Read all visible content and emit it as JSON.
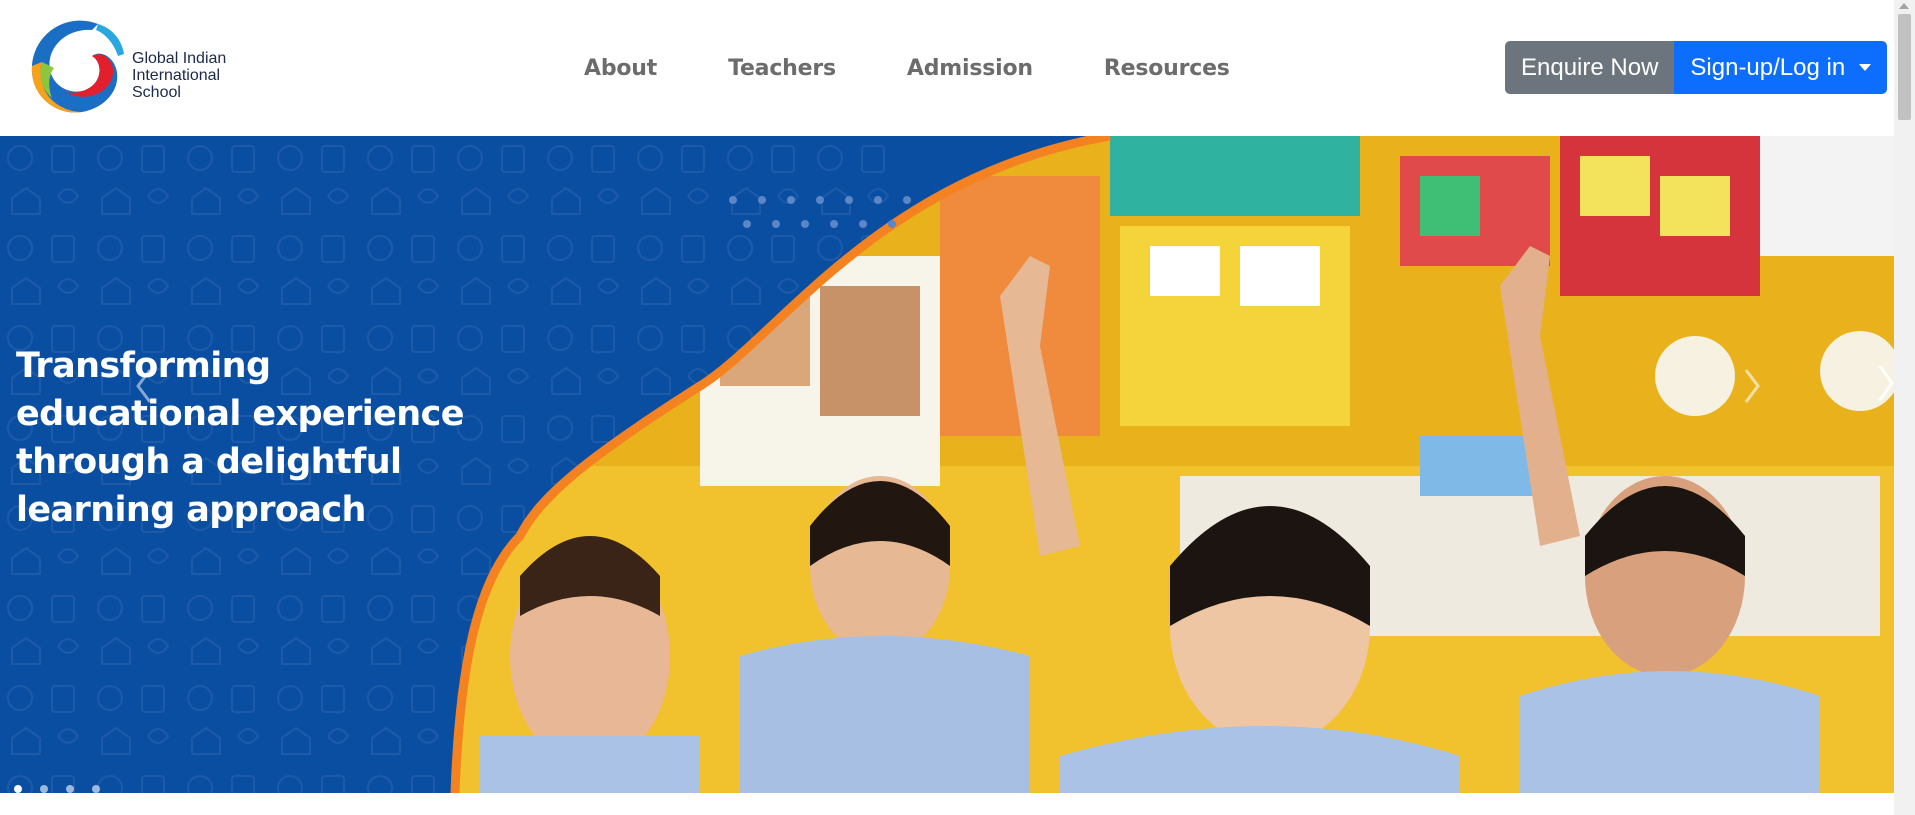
{
  "header": {
    "logo_lines": [
      "Global Indian",
      "International",
      "School"
    ],
    "nav": [
      {
        "label": "About"
      },
      {
        "label": "Teachers"
      },
      {
        "label": "Admission"
      },
      {
        "label": "Resources"
      }
    ],
    "enquire_label": "Enquire Now",
    "signup_label": "Sign-up/Log in"
  },
  "hero": {
    "headline": "Transforming educational experience through a delightful learning approach",
    "slide_count": 4,
    "active_slide": 1,
    "prev_icon": "chevron-left-icon",
    "next_icon": "chevron-right-icon"
  },
  "colors": {
    "brand_blue": "#0a4ea2",
    "accent_orange": "#f58220",
    "button_grey": "#6c757d",
    "button_blue": "#0d6efd",
    "nav_text": "#6c6c6c"
  }
}
